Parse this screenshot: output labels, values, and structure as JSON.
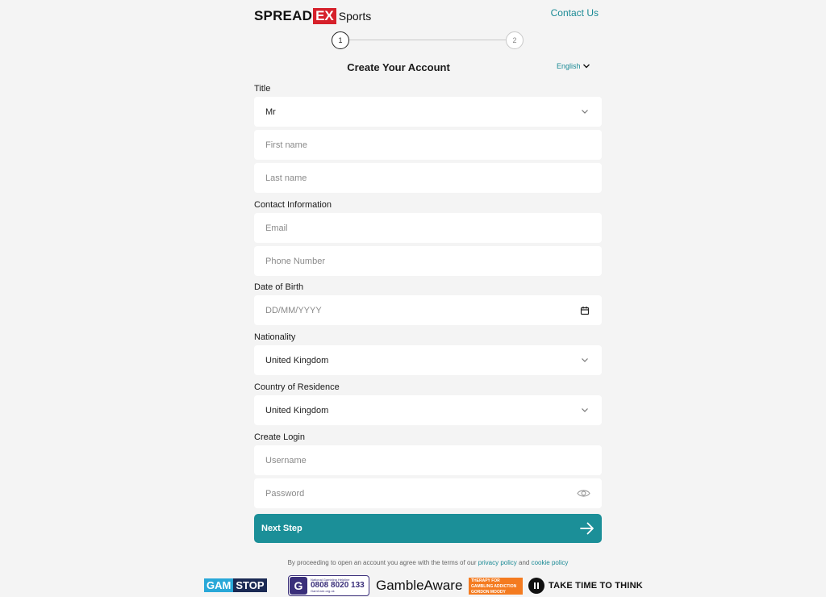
{
  "brand": {
    "logo_main": "SPREAD",
    "logo_ex": "EX",
    "logo_sub": "Sports",
    "accent_color": "#1b8f98",
    "logo_red": "#d6202a"
  },
  "header": {
    "contact_label": "Contact Us"
  },
  "stepper": {
    "steps": [
      "1",
      "2"
    ],
    "current_step": 1
  },
  "form": {
    "title": "Create Your Account",
    "language": "English",
    "sections": {
      "title_label": "Title",
      "contact_label": "Contact Information",
      "dob_label": "Date of Birth",
      "nationality_label": "Nationality",
      "residence_label": "Country of Residence",
      "login_label": "Create Login"
    },
    "fields": {
      "title_value": "Mr",
      "first_name_placeholder": "First name",
      "last_name_placeholder": "Last name",
      "email_placeholder": "Email",
      "phone_placeholder": "Phone Number",
      "dob_placeholder": "DD/MM/YYYY",
      "nationality_value": "United Kingdom",
      "residence_value": "United Kingdom",
      "username_placeholder": "Username",
      "password_placeholder": "Password"
    },
    "next_label": "Next Step",
    "terms": {
      "prefix": "By proceeding to open an account you agree with the terms of our",
      "privacy": "privacy policy",
      "and": "and",
      "cookie": "cookie policy"
    }
  },
  "footer": {
    "gamstop_a": "GAM",
    "gamstop_b": "STOP",
    "gamcare_small": "National Gambling Helpline",
    "gamcare_number": "0808 8020 133",
    "gamcare_url": "GamCare.org.uk",
    "gambleaware": "GambleAware",
    "gordon_lines": [
      "THERAPY FOR",
      "GAMBLING ADDICTION",
      "GORDON MOODY"
    ],
    "take_time": "TAKE TIME TO THINK"
  }
}
